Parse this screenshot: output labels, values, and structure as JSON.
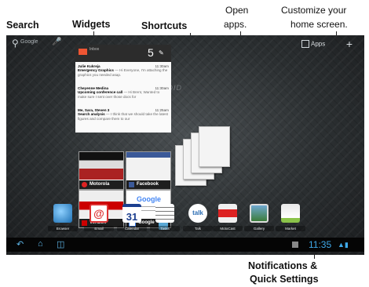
{
  "callouts": {
    "search": "Search",
    "widgets": "Widgets",
    "shortcuts": "Shortcuts",
    "open_apps_1": "Open",
    "open_apps_2": "apps.",
    "customize_1": "Customize your",
    "customize_2": "home screen.",
    "notifications_1": "Notifications &",
    "notifications_2": "Quick Settings"
  },
  "topbar": {
    "search_label": "Google",
    "apps_label": "Apps"
  },
  "email_widget": {
    "count": "5",
    "messages": [
      {
        "from": "Julie Kukreja",
        "time": "11:30am",
        "subject": "Emergency Graphics",
        "preview": "— Hi Everyone, I'm attaching the graphics you needed asap."
      },
      {
        "from": "Cheyenne Medina",
        "time": "11:30am",
        "subject": "Upcoming conference call",
        "preview": "— Hi Brent, Wanted to make sure I sent over those docs for"
      },
      {
        "from": "Me, Sara, Steven 3",
        "time": "11:25am",
        "subject": "Search analysis",
        "preview": "— I think that we should take the latest figures and compare them to our"
      }
    ]
  },
  "bookmarks": [
    {
      "label": "Motorola"
    },
    {
      "label": "Facebook"
    },
    {
      "label": "Verizon"
    },
    {
      "label": "Google"
    }
  ],
  "dock": [
    {
      "label": "Browser",
      "icon": "browser-icon"
    },
    {
      "label": "Email",
      "icon": "email-icon"
    },
    {
      "label": "Calendar",
      "icon": "calendar-icon",
      "glyph": "31"
    },
    {
      "label": "Tasks",
      "icon": "tasks-icon"
    },
    {
      "label": "Talk",
      "icon": "talk-icon",
      "glyph": "talk"
    },
    {
      "label": "MotoCast",
      "icon": "motocast-icon"
    },
    {
      "label": "Gallery",
      "icon": "gallery-icon"
    },
    {
      "label": "Market",
      "icon": "market-icon"
    }
  ],
  "sysbar": {
    "time": "11:35"
  },
  "colors": {
    "accent": "#3fa9e9"
  }
}
